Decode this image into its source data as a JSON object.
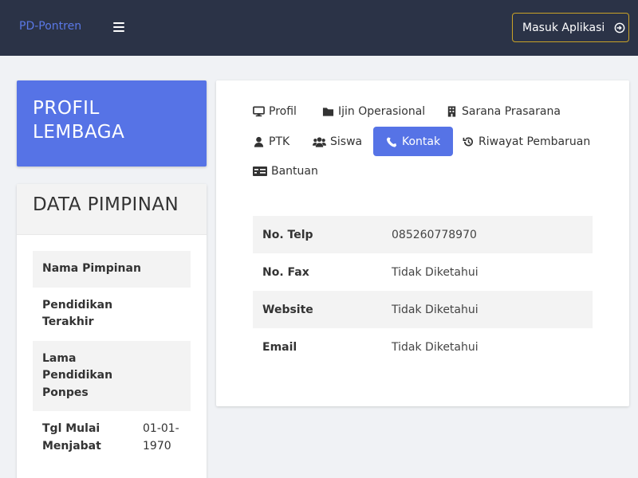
{
  "navbar": {
    "brand": "PD-Pontren",
    "login_label": "Masuk Aplikasi"
  },
  "sidebar": {
    "profil_title": "PROFIL LEMBAGA",
    "pimpinan_title": "DATA PIMPINAN",
    "rows": [
      {
        "label": "Nama Pimpinan",
        "value": ""
      },
      {
        "label": "Pendidikan Terakhir",
        "value": ""
      },
      {
        "label": "Lama Pendidikan Ponpes",
        "value": ""
      },
      {
        "label": "Tgl Mulai Menjabat",
        "value": "01-01-1970"
      }
    ]
  },
  "tabs": [
    {
      "label": "Profil",
      "icon": "desktop-icon"
    },
    {
      "label": "Ijin Operasional",
      "icon": "folder-icon"
    },
    {
      "label": "Sarana Prasarana",
      "icon": "building-icon"
    },
    {
      "label": "PTK",
      "icon": "user-icon"
    },
    {
      "label": "Siswa",
      "icon": "users-icon"
    },
    {
      "label": "Kontak",
      "icon": "phone-icon",
      "active": true
    },
    {
      "label": "Riwayat Pembaruan",
      "icon": "history-icon"
    },
    {
      "label": "Bantuan",
      "icon": "money-check-icon"
    }
  ],
  "contact": {
    "rows": [
      {
        "label": "No. Telp",
        "value": "085260778970"
      },
      {
        "label": "No. Fax",
        "value": "Tidak Diketahui"
      },
      {
        "label": "Website",
        "value": "Tidak Diketahui"
      },
      {
        "label": "Email",
        "value": "Tidak Diketahui"
      }
    ]
  },
  "colors": {
    "navbar": "#2b3347",
    "brand": "#5a78e6",
    "accent": "#5673e6",
    "login_border": "#c9a227"
  }
}
